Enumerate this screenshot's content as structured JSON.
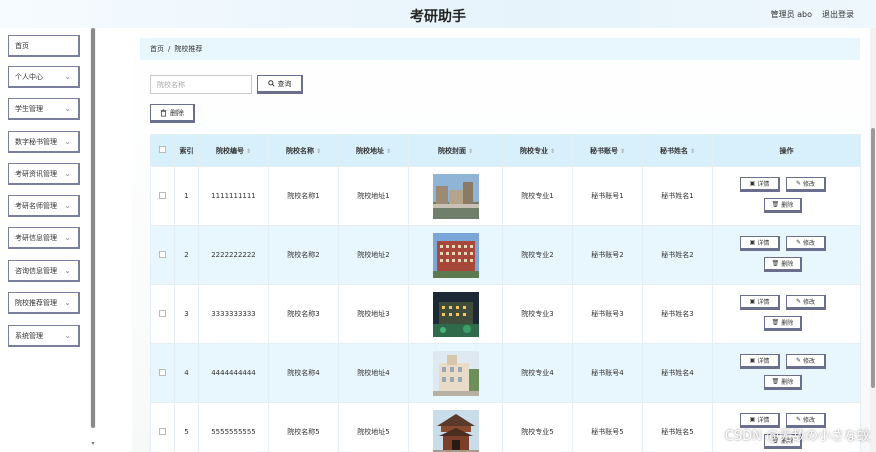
{
  "header": {
    "title": "考研助手",
    "user_label": "管理员 abo",
    "logout_label": "退出登录"
  },
  "sidebar": {
    "items": [
      {
        "label": "首页",
        "has_chevron": false
      },
      {
        "label": "个人中心",
        "has_chevron": true
      },
      {
        "label": "学生管理",
        "has_chevron": true
      },
      {
        "label": "数字秘书管理",
        "has_chevron": true
      },
      {
        "label": "考研资讯管理",
        "has_chevron": true
      },
      {
        "label": "考研名师管理",
        "has_chevron": true
      },
      {
        "label": "考研信息管理",
        "has_chevron": true
      },
      {
        "label": "咨询信息管理",
        "has_chevron": true
      },
      {
        "label": "院校推荐管理",
        "has_chevron": true
      },
      {
        "label": "系统管理",
        "has_chevron": true
      }
    ]
  },
  "breadcrumb": {
    "home": "首页",
    "separator": "/",
    "current": "院校推荐"
  },
  "search": {
    "placeholder": "院校名称",
    "button_label": "查询"
  },
  "toolbar": {
    "delete_label": "删除"
  },
  "table": {
    "columns": [
      "",
      "索引",
      "院校编号",
      "院校名称",
      "院校地址",
      "院校封面",
      "院校专业",
      "秘书账号",
      "秘书姓名",
      "操作"
    ],
    "rows": [
      {
        "index": "1",
        "code": "1111111111",
        "name": "院校名称1",
        "address": "院校地址1",
        "major": "院校专业1",
        "account": "秘书账号1",
        "sec_name": "秘书姓名1"
      },
      {
        "index": "2",
        "code": "2222222222",
        "name": "院校名称2",
        "address": "院校地址2",
        "major": "院校专业2",
        "account": "秘书账号2",
        "sec_name": "秘书姓名2"
      },
      {
        "index": "3",
        "code": "3333333333",
        "name": "院校名称3",
        "address": "院校地址3",
        "major": "院校专业3",
        "account": "秘书账号3",
        "sec_name": "秘书姓名3"
      },
      {
        "index": "4",
        "code": "4444444444",
        "name": "院校名称4",
        "address": "院校地址4",
        "major": "院校专业4",
        "account": "秘书账号4",
        "sec_name": "秘书姓名4"
      },
      {
        "index": "5",
        "code": "5555555555",
        "name": "院校名称5",
        "address": "院校地址5",
        "major": "院校专业5",
        "account": "秘书账号5",
        "sec_name": "秘书姓名5"
      }
    ],
    "actions": {
      "detail": "详情",
      "edit": "修改",
      "delete": "删除"
    }
  },
  "watermark": "CSDN @无敌の小さな蚊",
  "colors": {
    "header_bg": "#e6f3fb",
    "breadcrumb_bg": "#e8f6fd",
    "table_head_bg": "#d7f0fc",
    "row_alt_bg": "#e8f6fd",
    "button_border": "#6a6f90"
  }
}
